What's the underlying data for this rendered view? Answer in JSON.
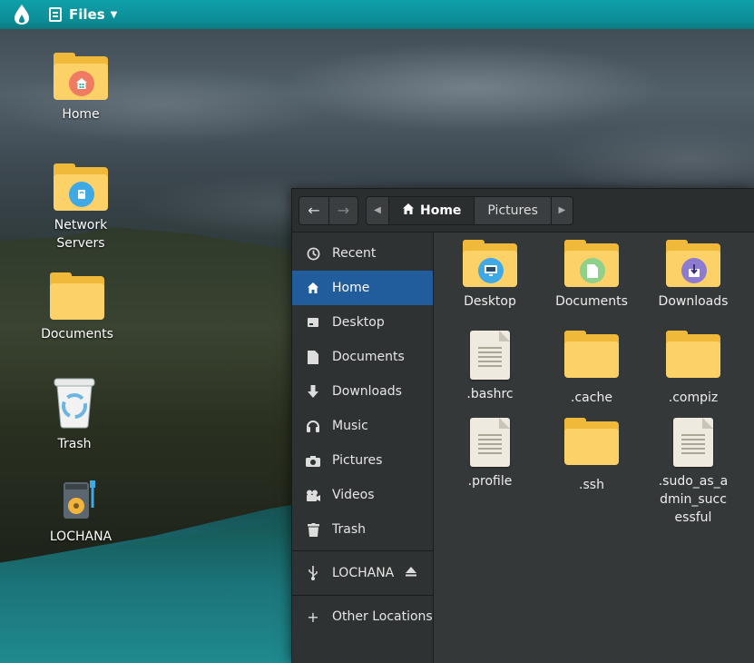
{
  "topbar": {
    "app_name": "Files"
  },
  "desktop": {
    "icons": [
      {
        "label": "Home"
      },
      {
        "label": "Network Servers"
      },
      {
        "label": "Documents"
      },
      {
        "label": "Trash"
      },
      {
        "label": "LOCHANA"
      }
    ]
  },
  "window": {
    "pathbar": {
      "crumbs": [
        "Home",
        "Pictures"
      ]
    },
    "sidebar": {
      "items": [
        {
          "label": "Recent",
          "icon": "clock-icon"
        },
        {
          "label": "Home",
          "icon": "home-icon",
          "active": true
        },
        {
          "label": "Desktop",
          "icon": "desktop-icon"
        },
        {
          "label": "Documents",
          "icon": "document-icon"
        },
        {
          "label": "Downloads",
          "icon": "download-icon"
        },
        {
          "label": "Music",
          "icon": "headphones-icon"
        },
        {
          "label": "Pictures",
          "icon": "camera-icon"
        },
        {
          "label": "Videos",
          "icon": "video-icon"
        },
        {
          "label": "Trash",
          "icon": "trash-icon"
        }
      ],
      "devices": [
        {
          "label": "LOCHANA",
          "icon": "usb-icon"
        }
      ],
      "other": {
        "label": "Other Locations",
        "icon": "plus-icon"
      }
    },
    "files": [
      {
        "label": "Desktop",
        "type": "folder"
      },
      {
        "label": "Documents",
        "type": "folder"
      },
      {
        "label": "Downloads",
        "type": "folder"
      },
      {
        "label": ".bashrc",
        "type": "file"
      },
      {
        "label": ".cache",
        "type": "folder"
      },
      {
        "label": ".compiz",
        "type": "folder"
      },
      {
        "label": ".profile",
        "type": "file"
      },
      {
        "label": ".ssh",
        "type": "folder"
      },
      {
        "label": ".sudo_as_admin_successful",
        "type": "file"
      }
    ]
  }
}
